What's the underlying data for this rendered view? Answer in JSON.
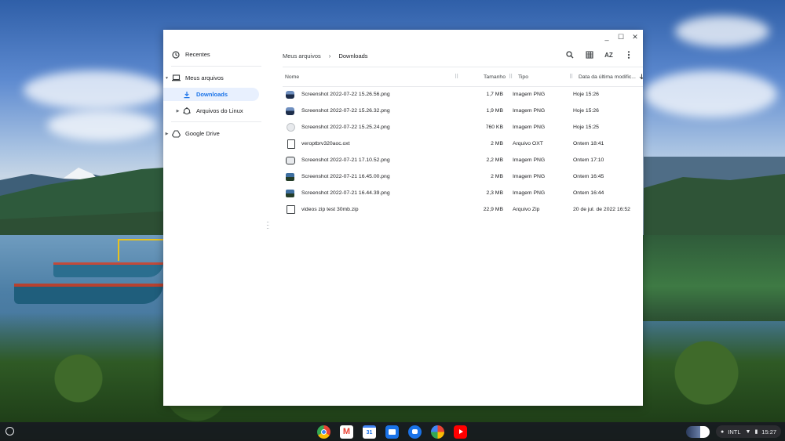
{
  "window": {
    "controls": [
      "_",
      "☐",
      "✕"
    ]
  },
  "sidebar": {
    "items": [
      {
        "label": "Recentes",
        "icon": "clock-icon"
      },
      {
        "label": "Meus arquivos",
        "icon": "laptop-icon",
        "expanded": true
      },
      {
        "label": "Downloads",
        "icon": "download-icon",
        "selected": true
      },
      {
        "label": "Arquivos do Linux",
        "icon": "linux-icon"
      },
      {
        "label": "Google Drive",
        "icon": "drive-icon"
      }
    ]
  },
  "breadcrumb": {
    "parent": "Meus arquivos",
    "current": "Downloads"
  },
  "toolbar": {
    "search_icon": "search-icon",
    "grid_icon": "grid-view-icon",
    "sort_label": "AZ",
    "more_icon": "more-vert-icon"
  },
  "columns": {
    "name": "Nome",
    "size": "Tamanho",
    "type": "Tipo",
    "date": "Data da última modific...",
    "sort": "descending"
  },
  "files": [
    {
      "name": "Screenshot 2022-07-22 15.26.56.png",
      "size": "1,7 MB",
      "type": "Imagem PNG",
      "date": "Hoje 15:26",
      "icon": "image-thumb"
    },
    {
      "name": "Screenshot 2022-07-22 15.26.32.png",
      "size": "1,9 MB",
      "type": "Imagem PNG",
      "date": "Hoje 15:26",
      "icon": "image-thumb"
    },
    {
      "name": "Screenshot 2022-07-22 15.25.24.png",
      "size": "760 KB",
      "type": "Imagem PNG",
      "date": "Hoje 15:25",
      "icon": "image-thumb-light"
    },
    {
      "name": "veroptbrv320aoc.oxt",
      "size": "2 MB",
      "type": "Arquivo OXT",
      "date": "Ontem 18:41",
      "icon": "document-icon"
    },
    {
      "name": "Screenshot 2022-07-21 17.10.52.png",
      "size": "2,2 MB",
      "type": "Imagem PNG",
      "date": "Ontem 17:10",
      "icon": "image-thumb-light"
    },
    {
      "name": "Screenshot 2022-07-21 16.45.00.png",
      "size": "2 MB",
      "type": "Imagem PNG",
      "date": "Ontem 16:45",
      "icon": "image-thumb-landscape"
    },
    {
      "name": "Screenshot 2022-07-21 16.44.39.png",
      "size": "2,3 MB",
      "type": "Imagem PNG",
      "date": "Ontem 16:44",
      "icon": "image-thumb-landscape"
    },
    {
      "name": "videos zip test 30mb.zip",
      "size": "22,9 MB",
      "type": "Arquivo Zip",
      "date": "20 de jul. de 2022 16:52",
      "icon": "zip-icon"
    }
  ],
  "shelf": {
    "apps": [
      "chrome-icon",
      "gmail-icon",
      "calendar-icon",
      "files-icon",
      "messages-icon",
      "photos-icon",
      "youtube-icon"
    ],
    "status": {
      "locale": "INTL",
      "time": "15:27"
    }
  }
}
